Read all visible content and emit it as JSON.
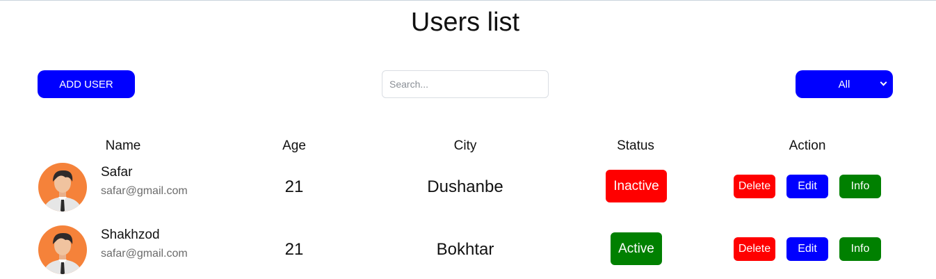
{
  "page": {
    "title": "Users list"
  },
  "toolbar": {
    "add_user_label": "ADD USER",
    "search_placeholder": "Search...",
    "search_value": "",
    "filter_selected": "All"
  },
  "table": {
    "headers": {
      "name": "Name",
      "age": "Age",
      "city": "City",
      "status": "Status",
      "action": "Action"
    },
    "rows": [
      {
        "name": "Safar",
        "email": "safar@gmail.com",
        "age": "21",
        "city": "Dushanbe",
        "status": "Inactive",
        "status_color": "#ff0000"
      },
      {
        "name": "Shakhzod",
        "email": "safar@gmail.com",
        "age": "21",
        "city": "Bokhtar",
        "status": "Active",
        "status_color": "#008000"
      }
    ],
    "actions": {
      "delete": "Delete",
      "edit": "Edit",
      "info": "Info"
    }
  },
  "colors": {
    "primary": "#0000ff",
    "danger": "#ff0000",
    "success": "#008000",
    "avatar_bg": "#f5823a"
  }
}
